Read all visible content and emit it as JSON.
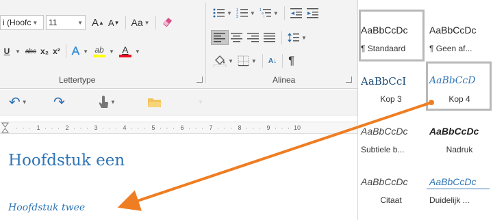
{
  "ribbon": {
    "font": {
      "font_name": "i (Hoofc",
      "font_size": "11",
      "grow_icon": "A",
      "shrink_icon": "A",
      "case_label": "Aa",
      "underline": "U",
      "strikethrough": "abc",
      "subscript": "x₂",
      "superscript": "x²",
      "effects_icon": "A",
      "highlight_icon": "ab",
      "font_color_icon": "A",
      "group_label": "Lettertype"
    },
    "paragraph": {
      "pilcrow": "¶",
      "sort": "A↓",
      "group_label": "Alinea"
    }
  },
  "qat": {
    "undo": "↶",
    "redo": "↷"
  },
  "ruler": {
    "ticks": [
      "1",
      "2",
      "3",
      "4",
      "5",
      "6",
      "7",
      "8",
      "9",
      "10"
    ]
  },
  "document": {
    "heading1": "Hoofdstuk een",
    "heading2": "Hoofdstuk twee"
  },
  "styles": [
    {
      "sample": "AaBbCcDc",
      "name": "¶ Standaard",
      "selected": true
    },
    {
      "sample": "AaBbCcDc",
      "name": "¶ Geen af..."
    },
    {
      "sample": "AaBbCcI",
      "name": "Kop 3"
    },
    {
      "sample": "AaBbCcD",
      "name": "Kop 4",
      "hover": true
    },
    {
      "sample": "AaBbCcDc",
      "name": "Subtiele b..."
    },
    {
      "sample": "AaBbCcDc",
      "name": "Nadruk"
    },
    {
      "sample": "AaBbCcDc",
      "name": "Citaat"
    },
    {
      "sample": "AaBbCcDc",
      "name": "Duidelijk ..."
    }
  ],
  "colors": {
    "heading_blue": "#2e74b5",
    "arrow_orange": "#ef7d22",
    "font_color_red": "#e81123",
    "highlight_yellow": "#ffff00"
  }
}
